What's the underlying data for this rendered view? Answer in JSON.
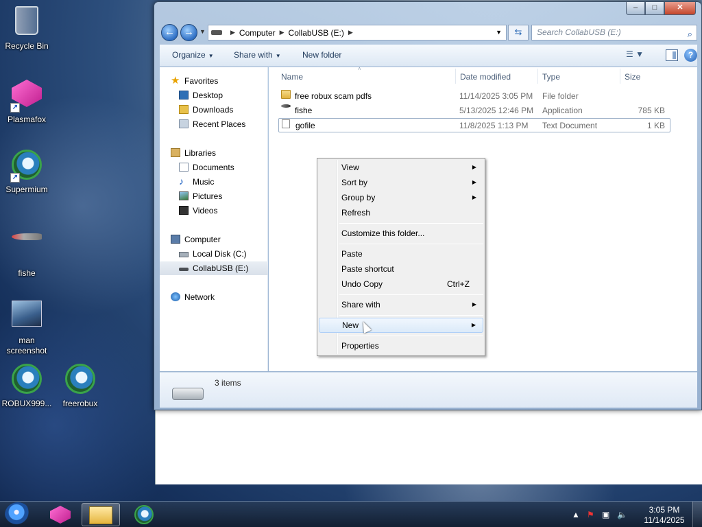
{
  "desktop": {
    "icons": [
      {
        "label": "Recycle Bin",
        "icon": "recycle-bin-icon"
      },
      {
        "label": "Plasmafox",
        "icon": "plasmafox-icon"
      },
      {
        "label": "Supermium",
        "icon": "supermium-icon"
      },
      {
        "label": "fishe",
        "icon": "fish-app-icon"
      },
      {
        "label": "man screenshot",
        "icon": "image-file-icon"
      },
      {
        "label": "ROBUX999...",
        "icon": "supermium-icon"
      },
      {
        "label": "freerobux",
        "icon": "supermium-icon"
      }
    ]
  },
  "window": {
    "caption": {
      "minimize": "–",
      "maximize": "□",
      "close": "✕"
    },
    "nav": {
      "back": "←",
      "forward": "→"
    },
    "address": {
      "segments": [
        "Computer",
        "CollabUSB (E:)"
      ]
    },
    "search": {
      "placeholder": "Search CollabUSB (E:)"
    },
    "toolbar": {
      "organize": "Organize",
      "share_with": "Share with",
      "new_folder": "New folder"
    },
    "navpane": {
      "favorites": "Favorites",
      "desktop": "Desktop",
      "downloads": "Downloads",
      "recent_places": "Recent Places",
      "libraries": "Libraries",
      "documents": "Documents",
      "music": "Music",
      "pictures": "Pictures",
      "videos": "Videos",
      "computer": "Computer",
      "local_disk": "Local Disk (C:)",
      "collabusb": "CollabUSB (E:)",
      "network": "Network"
    },
    "columns": {
      "name": "Name",
      "date": "Date modified",
      "type": "Type",
      "size": "Size"
    },
    "files": [
      {
        "name": "free robux scam pdfs",
        "date": "11/14/2025 3:05 PM",
        "type": "File folder",
        "size": ""
      },
      {
        "name": "fishe",
        "date": "5/13/2025 12:46 PM",
        "type": "Application",
        "size": "785 KB"
      },
      {
        "name": "gofile",
        "date": "11/8/2025 1:13 PM",
        "type": "Text Document",
        "size": "1 KB"
      }
    ],
    "details": {
      "count": "3 items"
    }
  },
  "context_menu": {
    "view": "View",
    "sort_by": "Sort by",
    "group_by": "Group by",
    "refresh": "Refresh",
    "customize": "Customize this folder...",
    "paste": "Paste",
    "paste_shortcut": "Paste shortcut",
    "undo_copy": "Undo Copy",
    "undo_shortcut": "Ctrl+Z",
    "share_with": "Share with",
    "new": "New",
    "properties": "Properties"
  },
  "taskbar": {
    "clock_time": "3:05 PM",
    "clock_date": "11/14/2025"
  }
}
